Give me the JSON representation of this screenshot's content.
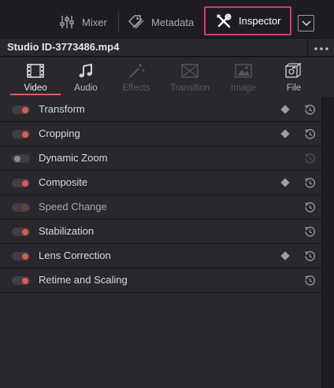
{
  "toolbar": {
    "mixer_label": "Mixer",
    "metadata_label": "Metadata",
    "inspector_label": "Inspector"
  },
  "clip": {
    "title": "Studio ID-3773486.mp4"
  },
  "tabs": [
    {
      "label": "Video",
      "icon": "film-icon",
      "state": "selected"
    },
    {
      "label": "Audio",
      "icon": "music-note-icon",
      "state": "enabled"
    },
    {
      "label": "Effects",
      "icon": "magic-wand-icon",
      "state": "disabled"
    },
    {
      "label": "Transition",
      "icon": "transition-icon",
      "state": "disabled"
    },
    {
      "label": "Image",
      "icon": "image-icon",
      "state": "disabled"
    },
    {
      "label": "File",
      "icon": "file-icon",
      "state": "enabled"
    }
  ],
  "properties": [
    {
      "label": "Transform",
      "enabled": true,
      "keyframe": true,
      "reset_active": true
    },
    {
      "label": "Cropping",
      "enabled": true,
      "keyframe": true,
      "reset_active": true
    },
    {
      "label": "Dynamic Zoom",
      "enabled": false,
      "keyframe": false,
      "reset_active": false
    },
    {
      "label": "Composite",
      "enabled": true,
      "keyframe": true,
      "reset_active": true
    },
    {
      "label": "Speed Change",
      "enabled": "dim",
      "keyframe": false,
      "reset_active": true
    },
    {
      "label": "Stabilization",
      "enabled": true,
      "keyframe": false,
      "reset_active": true
    },
    {
      "label": "Lens Correction",
      "enabled": true,
      "keyframe": true,
      "reset_active": true
    },
    {
      "label": "Retime and Scaling",
      "enabled": true,
      "keyframe": false,
      "reset_active": true
    }
  ],
  "colors": {
    "accent_red": "#e5584a",
    "highlight_border": "#e0356a",
    "panel_bg": "#28282d",
    "app_bg": "#1d1d21"
  }
}
